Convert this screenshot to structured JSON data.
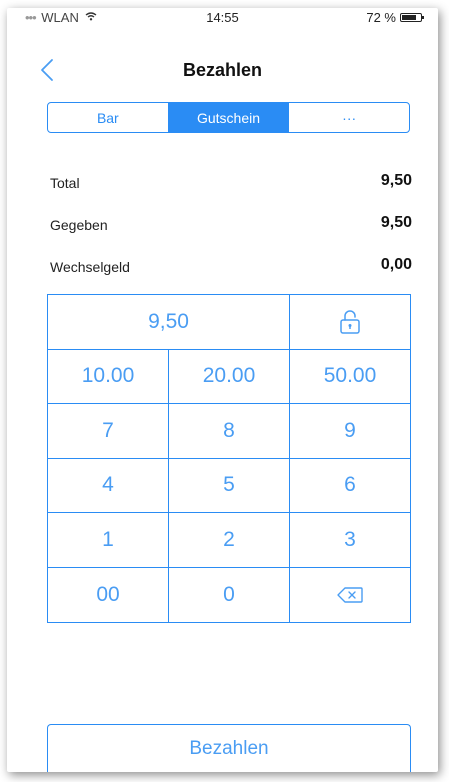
{
  "status_bar": {
    "carrier": "WLAN",
    "time": "14:55",
    "battery": "72 %"
  },
  "nav": {
    "title": "Bezahlen",
    "back_icon": "chevron-left-icon"
  },
  "payment_tabs": [
    {
      "label": "Bar",
      "active": false
    },
    {
      "label": "Gutschein",
      "active": true
    },
    {
      "label": "···",
      "active": false
    }
  ],
  "summary": {
    "total_label": "Total",
    "total_value": "9,50",
    "given_label": "Gegeben",
    "given_value": "9,50",
    "change_label": "Wechselgeld",
    "change_value": "0,00"
  },
  "keypad": {
    "display_value": "9,50",
    "lock_icon": "unlock-icon",
    "quick_amounts": [
      "10.00",
      "20.00",
      "50.00"
    ],
    "digits": [
      "7",
      "8",
      "9",
      "4",
      "5",
      "6",
      "1",
      "2",
      "3"
    ],
    "double_zero": "00",
    "zero": "0",
    "backspace_icon": "backspace-icon"
  },
  "pay_button": {
    "label": "Bezahlen"
  },
  "colors": {
    "accent": "#2a8cf4",
    "key_text": "#4a9df3"
  }
}
